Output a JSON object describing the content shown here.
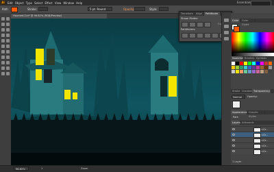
{
  "menubar": {
    "logo": "Ai",
    "items": [
      "Edit",
      "Object",
      "Type",
      "Select",
      "Effect",
      "View",
      "Window",
      "Help"
    ],
    "workspace": "Essentials"
  },
  "control_bar": {
    "object_type": "Path",
    "fill_color": "#ff5a00",
    "stroke_label": "Stroke:",
    "brush_value": "5 pt. Round",
    "opacity_label": "Opacity:",
    "style_label": "Style:"
  },
  "document": {
    "tab_title": "Haunted-Cut* @ 96.62% (RGB/Preview)"
  },
  "floating_panel": {
    "tabs": [
      "Transform",
      "Align",
      "Pathfinder"
    ],
    "shape_modes_label": "Shape Modes:",
    "expand_label": "Expand",
    "pathfinders_label": "Pathfinders:"
  },
  "color_panel": {
    "tabs": [
      "Color",
      "Color Guide"
    ],
    "accent": "#ff5a00"
  },
  "swatches_panel": {
    "tabs": [
      "Swatches",
      "Brushes",
      "Symbols"
    ]
  },
  "stroke_panel": {
    "tabs": [
      "Stroke",
      "Gradient",
      "Transparency"
    ],
    "blend_mode": "Normal",
    "opacity_label": "Opacity:"
  },
  "appearance_panel": {
    "tabs": [
      "Appearance",
      "Graphic Styles"
    ],
    "path_label": "Path"
  },
  "layers_panel": {
    "tabs": [
      "Layers",
      "Artboards"
    ],
    "layers": [
      "<Gr...",
      "<Gr...",
      "<Gr...",
      "<Gr...",
      "<Gr..."
    ],
    "footer": "1 Layer"
  },
  "status_bar": {
    "zoom": "96.62%",
    "artboard": "1",
    "tool_name": "Zoom"
  },
  "colors": {
    "sky": "#0f4f57",
    "house": "#2a7b80",
    "window_lit": "#f2e600",
    "fence": "#08161a",
    "ui_dark": "#2d2d2d"
  }
}
